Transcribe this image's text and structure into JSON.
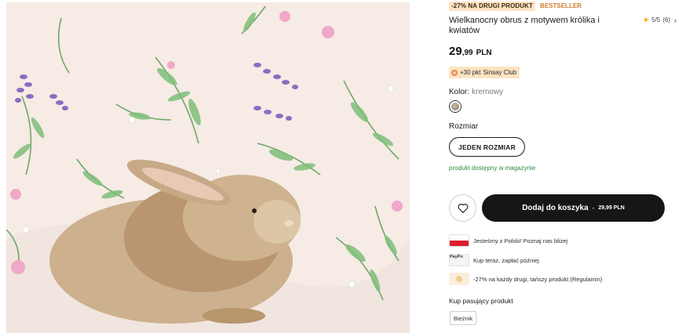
{
  "product": {
    "badge_promo": "-27% NA DRUGI PRODUKT",
    "badge_bestseller": "BESTSELLER",
    "title": "Wielkanocny obrus z motywem królika i kwiatów",
    "rating": {
      "text": "5/5",
      "count": "(6)",
      "value": 5,
      "max": 5
    },
    "price": {
      "main": "29",
      "decimal": ",99",
      "currency": "PLN"
    },
    "club_points": "+30 pkt",
    "club_name": "Sinsay Club",
    "color_label": "Kolor:",
    "color_value": "kremowy",
    "size_label": "Rozmiar",
    "size_option": "JEDEN ROZMIAR",
    "stock_text": "produkt dostępny w magazynie",
    "add_to_cart": "Dodaj do koszyka",
    "cart_separator": "-",
    "cart_price": "29,99 PLN"
  },
  "info_rows": [
    {
      "icon": "poland-flag-icon",
      "text": "Jesteśmy z Polski! Poznaj nas bliżej"
    },
    {
      "icon": "paypo-logo-icon",
      "logo_text": "PayPo",
      "text": "Kup teraz, zapłać później"
    },
    {
      "icon": "promo-coin-icon",
      "text": "-27% na każdy drugi, tańszy produkt (Regulamin)"
    }
  ],
  "match": {
    "label": "Kup pasujący produkt",
    "chip": "Bieżnik"
  },
  "colors": {
    "promo_bg": "#fde3c2",
    "bestseller": "#d07b2a",
    "stock_green": "#2e8a3d",
    "cart_bg": "#161616",
    "star": "#f0b400"
  }
}
